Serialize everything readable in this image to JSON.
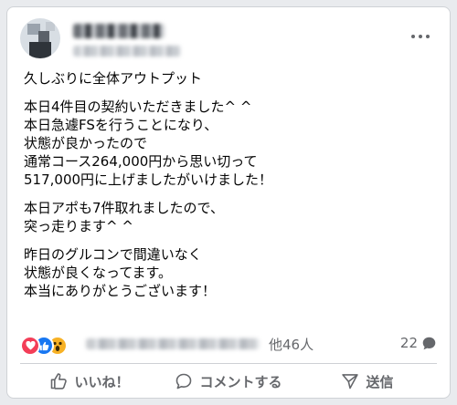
{
  "post": {
    "paragraphs": [
      [
        "久しぶりに全体アウトプット"
      ],
      [
        "本日4件目の契約いただきました^ ^",
        "本日急遽FSを行うことになり、",
        "状態が良かったので",
        "通常コース264,000円から思い切って",
        "517,000円に上げましたがいけました！"
      ],
      [
        "本日アポも7件取れましたので、",
        "突っ走ります^ ^"
      ],
      [
        "昨日のグルコンで間違いなく",
        "状態が良くなってます。",
        "本当にありがとうございます！"
      ]
    ]
  },
  "reactions": {
    "types": [
      "love",
      "like",
      "wow"
    ],
    "others_text": "他46人",
    "comment_count": "22"
  },
  "actions": {
    "like_label": "いいね！",
    "comment_label": "コメントする",
    "share_label": "送信"
  },
  "colors": {
    "like": "#1877f2",
    "love": "#f33e58",
    "wow": "#f7b125",
    "muted_text": "#65676b"
  }
}
